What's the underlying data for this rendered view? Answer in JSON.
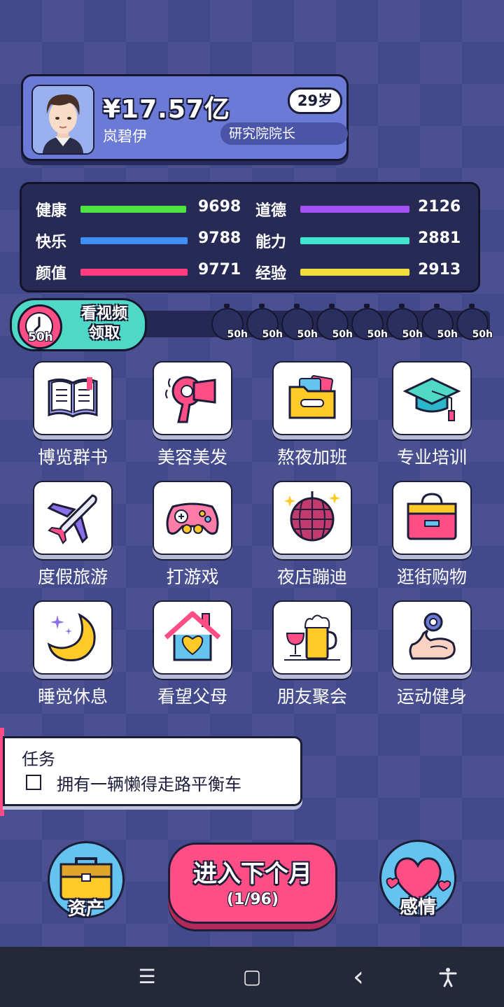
{
  "profile": {
    "money": "¥17.57亿",
    "name": "岚碧伊",
    "age": "29岁",
    "job": "研究院院长"
  },
  "stats": [
    {
      "label": "健康",
      "value": "9698",
      "color": "#4fe33f",
      "level": 0.97
    },
    {
      "label": "道德",
      "value": "2126",
      "color": "#a450f2",
      "level": 1.0
    },
    {
      "label": "快乐",
      "value": "9788",
      "color": "#3d8ef5",
      "level": 0.98
    },
    {
      "label": "能力",
      "value": "2881",
      "color": "#3fe6d2",
      "level": 1.0
    },
    {
      "label": "颜值",
      "value": "9771",
      "color": "#ff3d7f",
      "level": 0.98
    },
    {
      "label": "经验",
      "value": "2913",
      "color": "#f0dc3a",
      "level": 1.0
    }
  ],
  "video": {
    "badge": "50h",
    "line1": "看视频",
    "line2": "领取",
    "timers": [
      "50h",
      "50h",
      "50h",
      "50h",
      "50h",
      "50h",
      "50h",
      "50h"
    ]
  },
  "activities": [
    {
      "label": "博览群书",
      "icon": "book-icon"
    },
    {
      "label": "美容美发",
      "icon": "hair-dryer-icon"
    },
    {
      "label": "熬夜加班",
      "icon": "folder-icon"
    },
    {
      "label": "专业培训",
      "icon": "graduation-cap-icon"
    },
    {
      "label": "度假旅游",
      "icon": "airplane-icon"
    },
    {
      "label": "打游戏",
      "icon": "gamepad-icon"
    },
    {
      "label": "夜店蹦迪",
      "icon": "disco-ball-icon"
    },
    {
      "label": "逛街购物",
      "icon": "shopping-bag-icon"
    },
    {
      "label": "睡觉休息",
      "icon": "moon-icon"
    },
    {
      "label": "看望父母",
      "icon": "home-heart-icon"
    },
    {
      "label": "朋友聚会",
      "icon": "beer-icon"
    },
    {
      "label": "运动健身",
      "icon": "muscle-icon"
    }
  ],
  "task": {
    "title": "任务",
    "item": "拥有一辆懒得走路平衡车"
  },
  "bottom": {
    "assets": "资产",
    "next_title": "进入下个月",
    "next_progress": "(1/96)",
    "love": "感情"
  },
  "nav": {
    "menu": "☰",
    "home": "▢",
    "back": "‹"
  },
  "colors": {
    "background": "#434a8c",
    "accent_pink": "#ff4e86",
    "accent_teal": "#4fd8c5"
  }
}
